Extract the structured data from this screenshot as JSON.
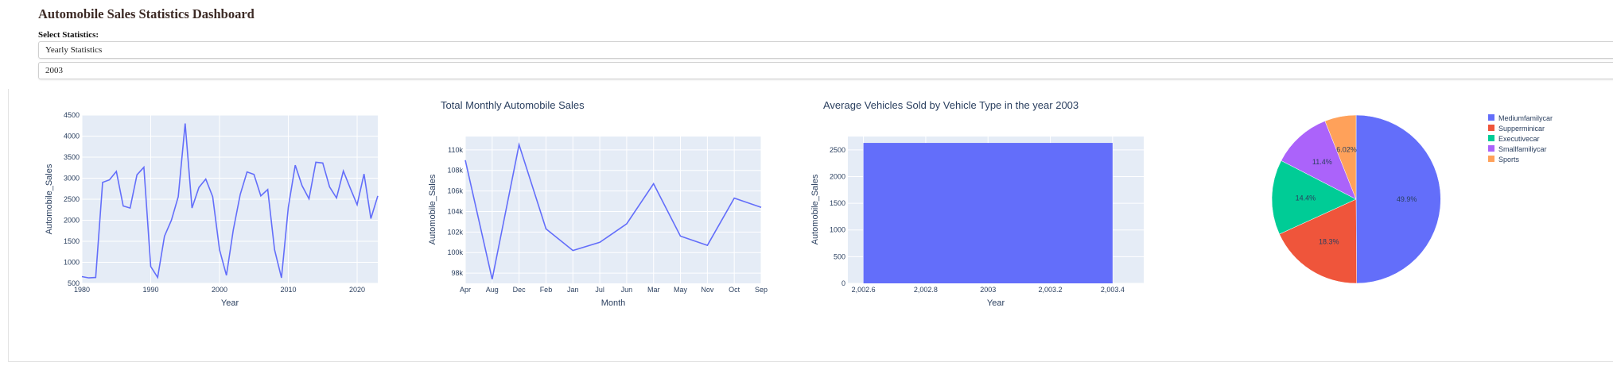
{
  "page": {
    "title": "Automobile Sales Statistics Dashboard",
    "select_label": "Select Statistics:",
    "statistics_dropdown": {
      "value": "Yearly Statistics"
    },
    "year_dropdown": {
      "value": "2003"
    }
  },
  "colors": {
    "plot_bg": "#e5ecf6",
    "line": "#636efa",
    "bar": "#636efa",
    "pie": [
      "#636efa",
      "#ef553b",
      "#00cc96",
      "#ab63fa",
      "#ffa15a"
    ]
  },
  "chart_data": [
    {
      "type": "line",
      "title": "",
      "xlabel": "Year",
      "ylabel": "Automobile_Sales",
      "xlim": [
        1980,
        2023
      ],
      "ylim": [
        500,
        4500
      ],
      "xticks": [
        "1980",
        "1990",
        "2000",
        "2010",
        "2020"
      ],
      "yticks": [
        "500",
        "1000",
        "1500",
        "2000",
        "2500",
        "3000",
        "3500",
        "4000",
        "4500"
      ],
      "x": [
        1980,
        1981,
        1982,
        1983,
        1984,
        1985,
        1986,
        1987,
        1988,
        1989,
        1990,
        1991,
        1992,
        1993,
        1994,
        1995,
        1996,
        1997,
        1998,
        1999,
        2000,
        2001,
        2002,
        2003,
        2004,
        2005,
        2006,
        2007,
        2008,
        2009,
        2010,
        2011,
        2012,
        2013,
        2014,
        2015,
        2016,
        2017,
        2018,
        2019,
        2020,
        2021,
        2022,
        2023
      ],
      "values": [
        660,
        630,
        640,
        2900,
        2960,
        3160,
        2340,
        2290,
        3080,
        3260,
        900,
        640,
        1620,
        2000,
        2560,
        4300,
        2290,
        2780,
        2980,
        2560,
        1300,
        690,
        1770,
        2610,
        3150,
        3090,
        2580,
        2730,
        1300,
        630,
        2310,
        3310,
        2820,
        2510,
        3380,
        3360,
        2790,
        2530,
        3170,
        2760,
        2370,
        3100,
        2040,
        2580
      ],
      "grid": true
    },
    {
      "type": "line",
      "title": "Total Monthly Automobile Sales",
      "xlabel": "Month",
      "ylabel": "Automobile_Sales",
      "categories": [
        "Apr",
        "Aug",
        "Dec",
        "Feb",
        "Jan",
        "Jul",
        "Jun",
        "Mar",
        "May",
        "Nov",
        "Oct",
        "Sep"
      ],
      "values": [
        109000,
        97400,
        110500,
        102300,
        100200,
        101000,
        102800,
        106700,
        101600,
        100700,
        105300,
        104400
      ],
      "ylim": [
        97000,
        111300
      ],
      "yticks": [
        "98k",
        "100k",
        "102k",
        "104k",
        "106k",
        "108k",
        "110k"
      ],
      "grid": true
    },
    {
      "type": "bar",
      "title": "Average Vehicles Sold by Vehicle Type in the year 2003",
      "xlabel": "Year",
      "ylabel": "Automobile_Sales",
      "x": [
        2003
      ],
      "values": [
        2630
      ],
      "xlim": [
        2002.55,
        2003.5
      ],
      "ylim": [
        0,
        2750
      ],
      "xticks": [
        "2,002.6",
        "2,002.8",
        "2003",
        "2,003.2",
        "2,003.4"
      ],
      "yticks": [
        "0",
        "500",
        "1000",
        "1500",
        "2000",
        "2500"
      ],
      "grid": true
    },
    {
      "type": "pie",
      "title": "",
      "labels": [
        "Mediumfamilycar",
        "Supperminicar",
        "Executivecar",
        "Smallfamiliycar",
        "Sports"
      ],
      "values": [
        49.9,
        18.3,
        14.4,
        11.4,
        6.02
      ],
      "value_labels": [
        "49.9%",
        "18.3%",
        "14.4%",
        "11.4%",
        "6.02%"
      ],
      "legend": "right"
    }
  ]
}
